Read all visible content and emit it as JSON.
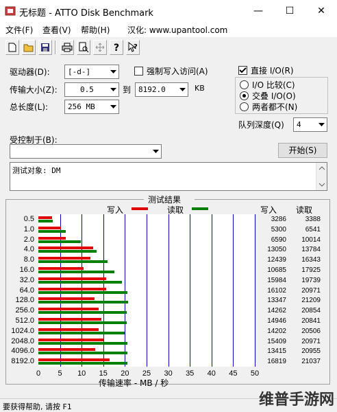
{
  "window": {
    "title": "无标题 - ATTO Disk Benchmark",
    "minimize": "—",
    "maximize": "☐",
    "close": "✕"
  },
  "menu": {
    "file": "文件(F)",
    "view": "查看(V)",
    "help": "帮助(H)",
    "localized": "汉化: www.upantool.com"
  },
  "toolbar": {
    "icons": [
      "new-file-icon",
      "open-folder-icon",
      "save-icon",
      "print-icon",
      "print-preview-icon",
      "move-icon",
      "help-icon",
      "context-help-icon"
    ]
  },
  "settings": {
    "drive_label": "驱动器(D):",
    "drive_value": "[-d-]",
    "force_write_label": "强制写入访问(A)",
    "direct_io_label": "直接 I/O(R)",
    "transfer_label": "传输大小(Z):",
    "transfer_from": "0.5",
    "to_label": "到",
    "transfer_to": "8192.0",
    "kb_label": "KB",
    "overlap_label": "I/O 比较(C)",
    "overlapped_label": "交叠 I/O(O)",
    "neither_label": "两者都不(N)",
    "total_label": "总长度(L):",
    "total_value": "256 MB",
    "queue_label": "队列深度(Q)",
    "queue_value": "4",
    "controlled_label": "受控制于(B):",
    "start_label": "开始(S)",
    "description": "测试对象: DM"
  },
  "results": {
    "title": "测试结果",
    "write_legend": "写入",
    "read_legend": "读取",
    "write_header": "写入",
    "read_header": "读取",
    "xlabel": "传输速率 - MB / 秒",
    "write_color": "#e00000",
    "read_color": "#008000"
  },
  "chart_data": {
    "type": "bar",
    "title": "测试结果",
    "xlabel": "传输速率 - MB / 秒",
    "xlim": [
      0,
      50
    ],
    "xticks": [
      "0",
      "5",
      "10",
      "15",
      "20",
      "25",
      "30",
      "35",
      "40",
      "45",
      "50"
    ],
    "categories": [
      "0.5",
      "1.0",
      "2.0",
      "4.0",
      "8.0",
      "16.0",
      "32.0",
      "64.0",
      "128.0",
      "256.0",
      "512.0",
      "1024.0",
      "2048.0",
      "4096.0",
      "8192.0"
    ],
    "series": [
      {
        "name": "写入",
        "values_kb": [
          "3286",
          "5300",
          "6590",
          "13050",
          "12439",
          "10685",
          "15984",
          "16102",
          "13347",
          "14262",
          "14946",
          "14202",
          "15409",
          "13415",
          "16819"
        ],
        "values": [
          3.2,
          5.2,
          6.4,
          12.7,
          12.1,
          10.4,
          15.6,
          15.7,
          13.0,
          13.9,
          14.6,
          13.9,
          15.0,
          13.1,
          16.4
        ]
      },
      {
        "name": "读取",
        "values_kb": [
          "3388",
          "6541",
          "10014",
          "13784",
          "16343",
          "17925",
          "19739",
          "20971",
          "21209",
          "20854",
          "20841",
          "20506",
          "20971",
          "20955",
          "21037"
        ],
        "values": [
          3.3,
          6.4,
          9.8,
          13.5,
          16.0,
          17.5,
          19.3,
          20.5,
          20.7,
          20.4,
          20.4,
          20.0,
          20.5,
          20.5,
          20.5
        ]
      }
    ]
  },
  "status": {
    "text": "要获得帮助, 请按 F1"
  },
  "watermark": "维普手游网"
}
